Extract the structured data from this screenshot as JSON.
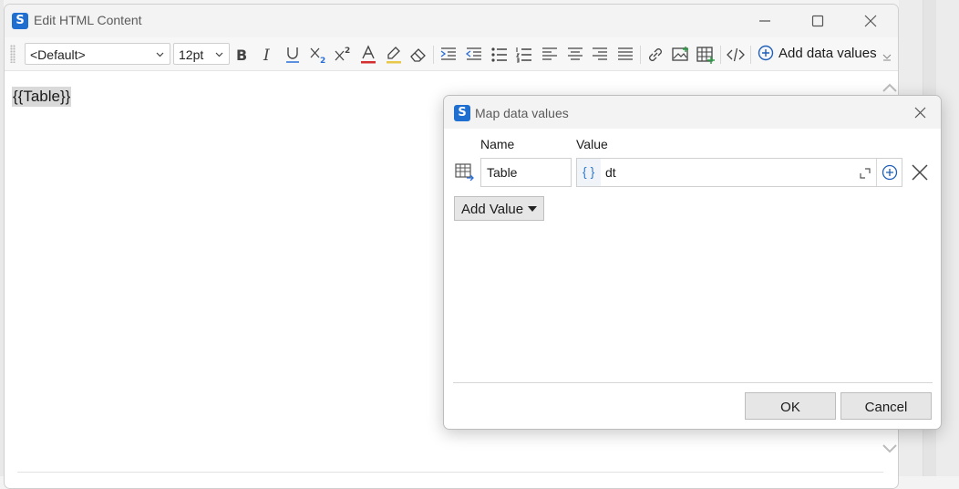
{
  "main_window": {
    "title": "Edit HTML Content",
    "app_icon_glyph": "S",
    "controls": [
      "minimize-icon",
      "maximize-icon",
      "close-icon"
    ]
  },
  "toolbar": {
    "style_value": "<Default>",
    "font_size_value": "12pt",
    "add_data_values_label": "Add data values",
    "buttons": [
      "bold",
      "italic",
      "underline",
      "subscript",
      "superscript",
      "font-color",
      "highlight",
      "clear-format",
      "indent",
      "outdent",
      "bullet-list",
      "numbered-list",
      "align-left",
      "align-center",
      "align-right",
      "justify",
      "link",
      "image",
      "table",
      "source-code"
    ]
  },
  "editor": {
    "content": "{{Table}}"
  },
  "dialog": {
    "title": "Map data values",
    "app_icon_glyph": "S",
    "columns": {
      "name": "Name",
      "value": "Value"
    },
    "rows": [
      {
        "name": "Table",
        "value_prefix": "{ }",
        "value": "dt"
      }
    ],
    "add_value_label": "Add Value",
    "ok_label": "OK",
    "cancel_label": "Cancel"
  },
  "colors": {
    "accent": "#1f6fd1",
    "brace": "#2f7ad1",
    "font_color_bar": "#d32f2f",
    "underline_blue": "#2a6fd6"
  }
}
